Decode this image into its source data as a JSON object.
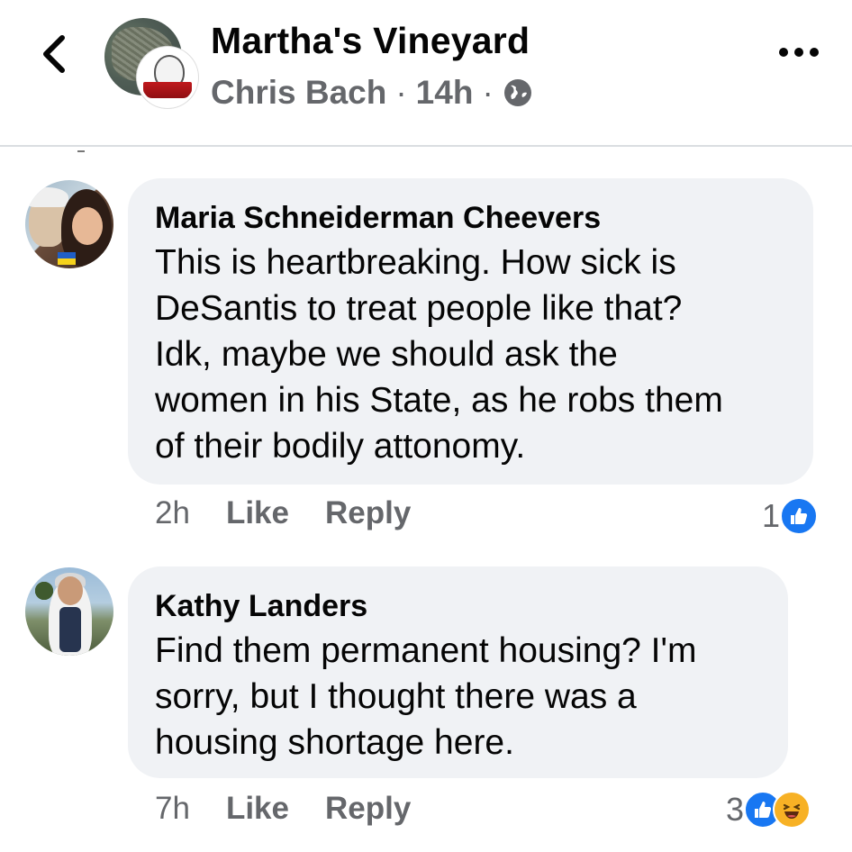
{
  "header": {
    "back_icon": "chevron-left-icon",
    "group_name": "Martha's Vineyard",
    "author": "Chris Bach",
    "separator": "·",
    "time": "14h",
    "privacy_icon": "globe-icon",
    "more_icon": "more-horizontal-icon"
  },
  "comments": [
    {
      "author": "Maria Schneiderman Cheevers",
      "lines": [
        "This is heartbreaking. How sick is",
        "DeSantis to treat people like that?",
        "Idk, maybe we should ask the",
        "women in his State, as he robs them",
        "of their bodily attonomy."
      ],
      "time": "2h",
      "like_label": "Like",
      "reply_label": "Reply",
      "reaction_count": "1",
      "reactions": [
        "like"
      ]
    },
    {
      "author": "Kathy Landers",
      "lines": [
        "Find them permanent housing? I'm",
        "sorry, but I thought there was a",
        "housing shortage here."
      ],
      "time": "7h",
      "like_label": "Like",
      "reply_label": "Reply",
      "reaction_count": "3",
      "reactions": [
        "like",
        "haha"
      ]
    }
  ],
  "colors": {
    "bubble": "#f0f2f5",
    "secondary_text": "#65676b",
    "like_blue": "#1877f2",
    "haha_yellow": "#f7b125"
  }
}
